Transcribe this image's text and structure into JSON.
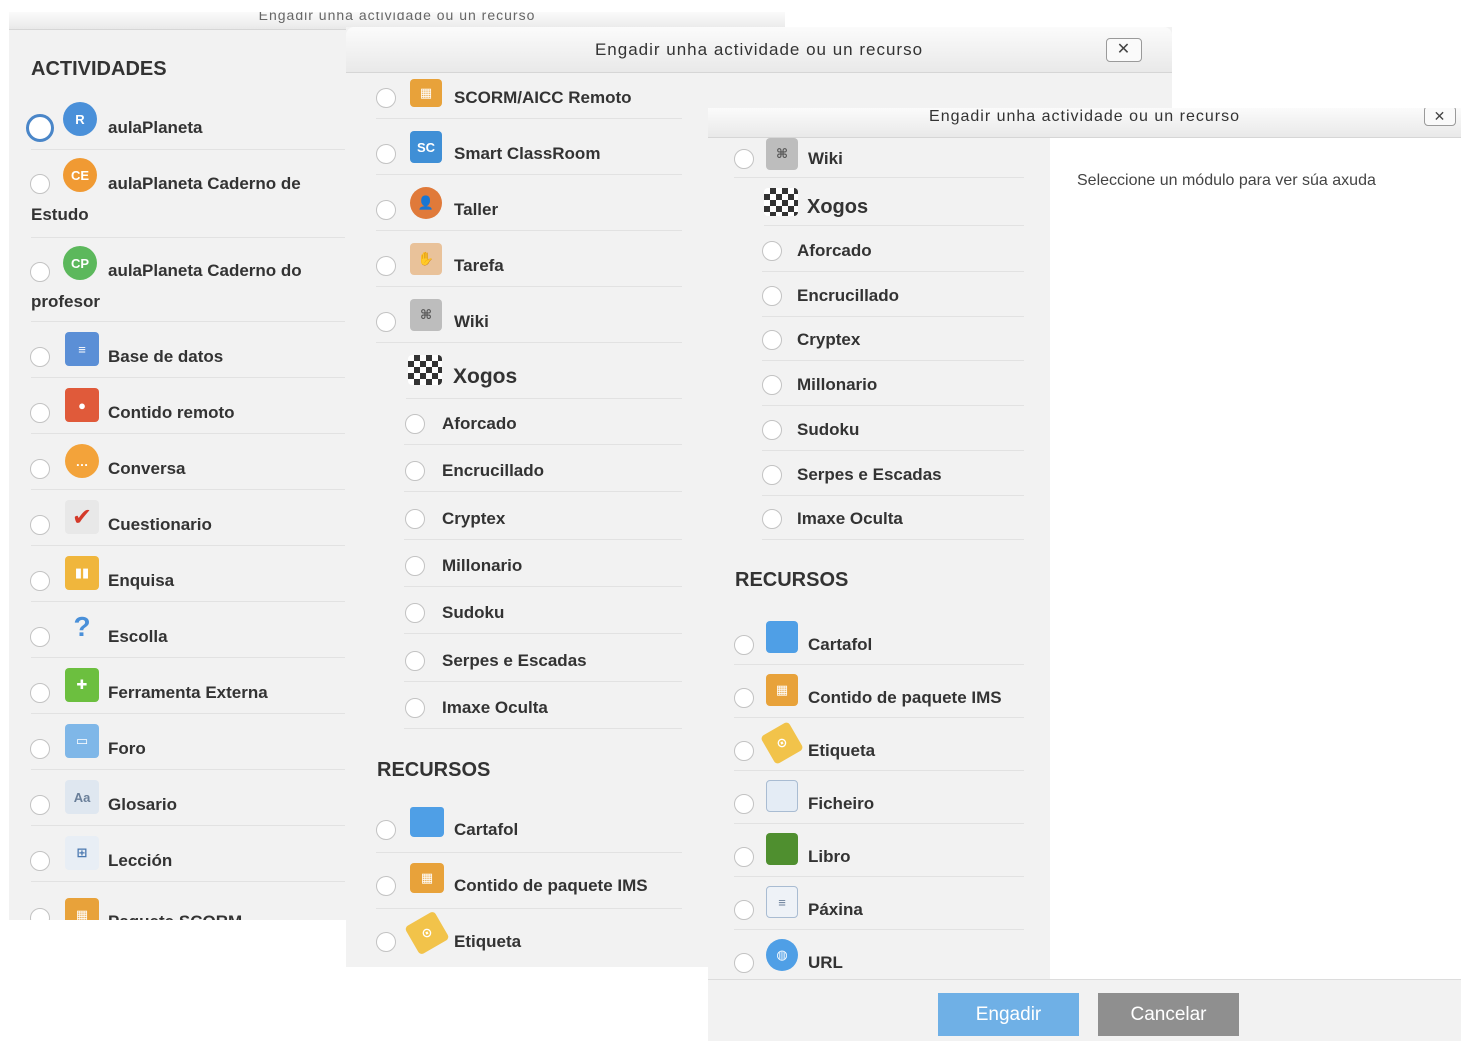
{
  "window_title": "Engadir unha actividade ou un recurso",
  "close_label": "✕",
  "panel1": {
    "section_activities": "ACTIVIDADES",
    "items": [
      {
        "label": "aulaPlaneta"
      },
      {
        "label": "aulaPlaneta Caderno de Estudo"
      },
      {
        "label": "aulaPlaneta Caderno do profesor"
      },
      {
        "label": "Base de datos"
      },
      {
        "label": "Contido remoto"
      },
      {
        "label": "Conversa"
      },
      {
        "label": "Cuestionario"
      },
      {
        "label": "Enquisa"
      },
      {
        "label": "Escolla"
      },
      {
        "label": "Ferramenta Externa"
      },
      {
        "label": "Foro"
      },
      {
        "label": "Glosario"
      },
      {
        "label": "Lección"
      },
      {
        "label": "Paquete SCORM"
      }
    ]
  },
  "panel2": {
    "items": [
      {
        "label": "SCORM/AICC Remoto"
      },
      {
        "label": "Smart ClassRoom"
      },
      {
        "label": "Taller"
      },
      {
        "label": "Tarefa"
      },
      {
        "label": "Wiki"
      }
    ],
    "group_label": "Xogos",
    "games": [
      "Aforcado",
      "Encrucillado",
      "Cryptex",
      "Millonario",
      "Sudoku",
      "Serpes e Escadas",
      "Imaxe Oculta"
    ],
    "section_resources": "RECURSOS",
    "resources": [
      {
        "label": "Cartafol"
      },
      {
        "label": "Contido de paquete IMS"
      },
      {
        "label": "Etiqueta"
      }
    ]
  },
  "panel3": {
    "items": [
      {
        "label": "Wiki"
      }
    ],
    "group_label": "Xogos",
    "games": [
      "Aforcado",
      "Encrucillado",
      "Cryptex",
      "Millonario",
      "Sudoku",
      "Serpes e Escadas",
      "Imaxe Oculta"
    ],
    "section_resources": "RECURSOS",
    "resources": [
      {
        "label": "Cartafol"
      },
      {
        "label": "Contido de paquete IMS"
      },
      {
        "label": "Etiqueta"
      },
      {
        "label": "Ficheiro"
      },
      {
        "label": "Libro"
      },
      {
        "label": "Páxina"
      },
      {
        "label": "URL"
      }
    ],
    "help_text": "Seleccione un módulo para ver súa axuda",
    "add_button": "Engadir",
    "cancel_button": "Cancelar"
  },
  "colors": {
    "accent": "#6fb0e6",
    "cancel": "#8f8f8f",
    "radio_selected": "#4a86c8"
  }
}
